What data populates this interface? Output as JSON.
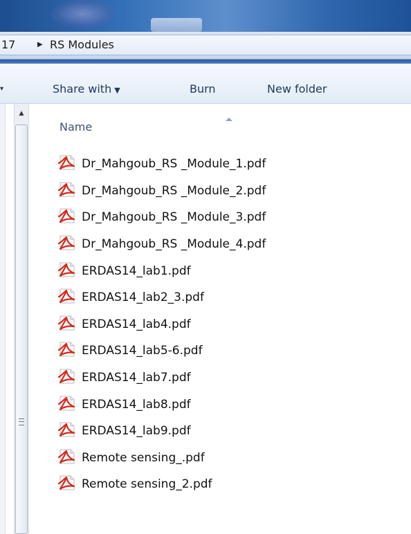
{
  "address_bar": {
    "previous_crumb": "17",
    "current_folder": "RS Modules"
  },
  "toolbar": {
    "share_with_label": "Share with",
    "burn_label": "Burn",
    "new_folder_label": "New folder"
  },
  "file_list": {
    "column_name": "Name",
    "files": [
      {
        "name": "Dr_Mahgoub_RS  _Module_1.pdf",
        "icon": "pdf-file-icon"
      },
      {
        "name": "Dr_Mahgoub_RS  _Module_2.pdf",
        "icon": "pdf-file-icon"
      },
      {
        "name": "Dr_Mahgoub_RS  _Module_3.pdf",
        "icon": "pdf-file-icon"
      },
      {
        "name": "Dr_Mahgoub_RS  _Module_4.pdf",
        "icon": "pdf-file-icon"
      },
      {
        "name": "ERDAS14_lab1.pdf",
        "icon": "pdf-file-icon"
      },
      {
        "name": "ERDAS14_lab2_3.pdf",
        "icon": "pdf-file-icon"
      },
      {
        "name": "ERDAS14_lab4.pdf",
        "icon": "pdf-file-icon"
      },
      {
        "name": "ERDAS14_lab5-6.pdf",
        "icon": "pdf-file-icon"
      },
      {
        "name": "ERDAS14_lab7.pdf",
        "icon": "pdf-file-icon"
      },
      {
        "name": "ERDAS14_lab8.pdf",
        "icon": "pdf-file-icon"
      },
      {
        "name": "ERDAS14_lab9.pdf",
        "icon": "pdf-file-icon"
      },
      {
        "name": "Remote sensing_.pdf",
        "icon": "pdf-file-icon"
      },
      {
        "name": "Remote sensing_2.pdf",
        "icon": "pdf-file-icon"
      }
    ]
  },
  "colors": {
    "pdf_red": "#d42a1c",
    "toolbar_text": "#1e3a5a",
    "header_text": "#3b5375"
  }
}
